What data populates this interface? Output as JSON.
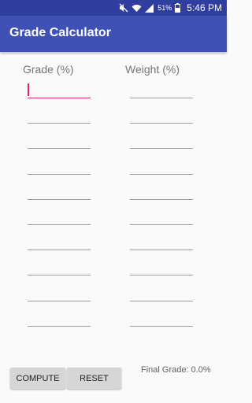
{
  "status_bar": {
    "battery": "51%",
    "time": "5:46 PM"
  },
  "app": {
    "title": "Grade Calculator"
  },
  "columns": {
    "grade_header": "Grade (%)",
    "weight_header": "Weight (%)"
  },
  "rows": [
    {
      "grade": "",
      "weight": ""
    },
    {
      "grade": "",
      "weight": ""
    },
    {
      "grade": "",
      "weight": ""
    },
    {
      "grade": "",
      "weight": ""
    },
    {
      "grade": "",
      "weight": ""
    },
    {
      "grade": "",
      "weight": ""
    },
    {
      "grade": "",
      "weight": ""
    },
    {
      "grade": "",
      "weight": ""
    },
    {
      "grade": "",
      "weight": ""
    },
    {
      "grade": "",
      "weight": ""
    }
  ],
  "buttons": {
    "compute_label": "COMPUTE",
    "reset_label": "RESET"
  },
  "result": {
    "final_grade_text": "Final Grade: 0.0%"
  },
  "colors": {
    "primary": "#3f51b5",
    "primary_dark": "#303f9f",
    "accent": "#e91e63"
  }
}
